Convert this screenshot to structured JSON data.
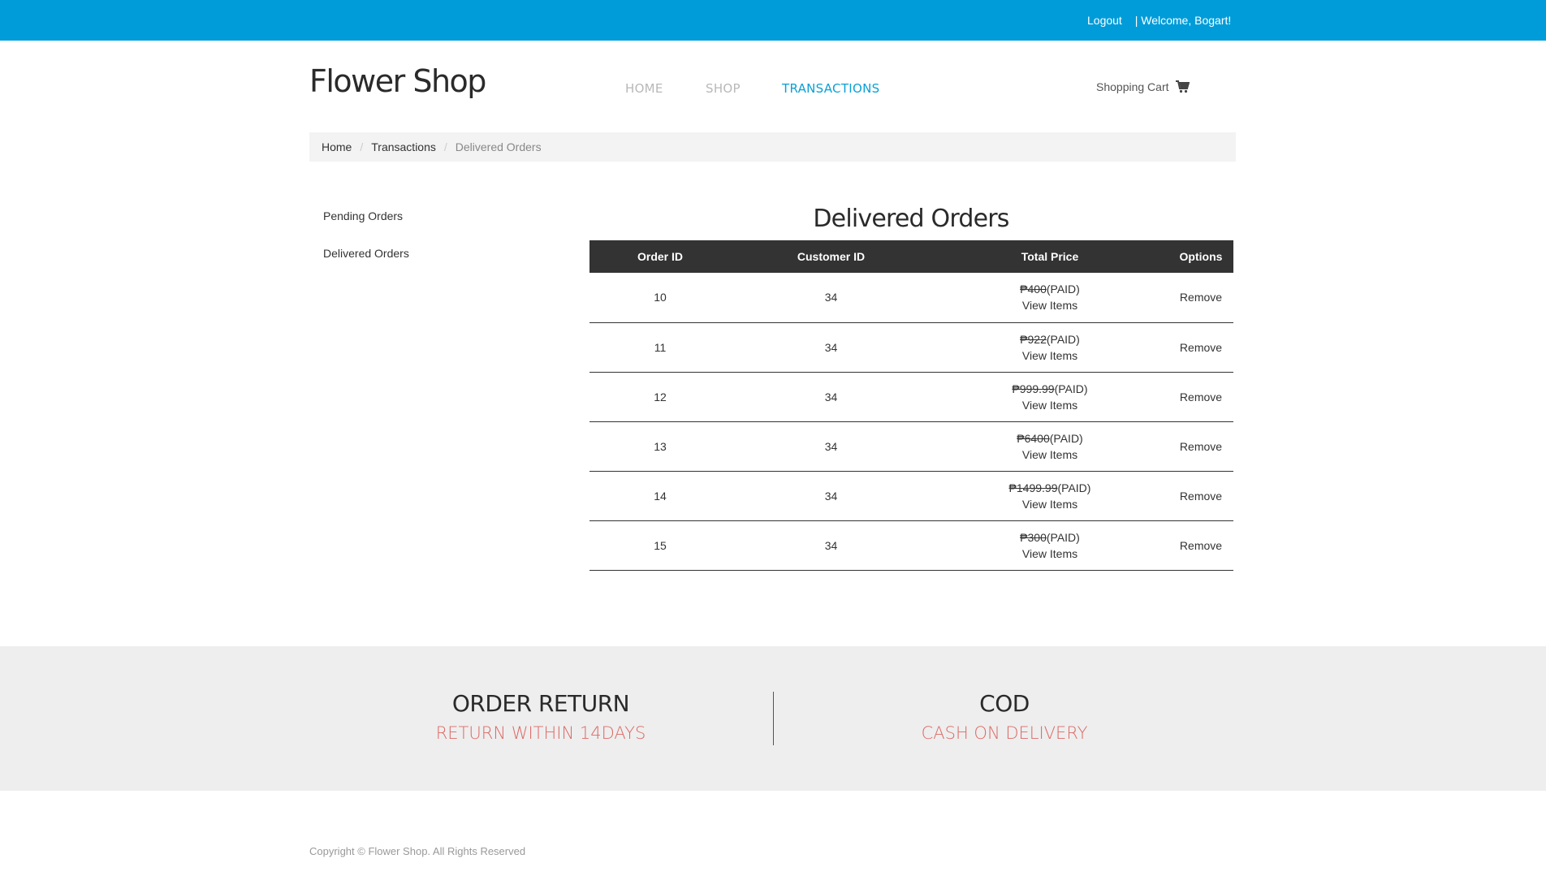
{
  "topbar": {
    "logout": "Logout",
    "welcome": "| Welcome,  Bogart!"
  },
  "header": {
    "logo": "Flower Shop",
    "nav": {
      "home": "HOME",
      "shop": "SHOP",
      "transactions": "TRANSACTIONS"
    },
    "cart_label": "Shopping Cart",
    "cart_icon": "shopping-cart-icon"
  },
  "breadcrumb": [
    "Home",
    "Transactions",
    "Delivered Orders"
  ],
  "sidebar": [
    "Pending Orders",
    "Delivered Orders"
  ],
  "main": {
    "title": "Delivered Orders",
    "columns": [
      "Order ID",
      "Customer ID",
      "Total Price",
      "Options"
    ],
    "rows": [
      {
        "order_id": "10",
        "customer_id": "34",
        "price": "₱400",
        "status": "(PAID)",
        "view": "View Items",
        "option": "Remove"
      },
      {
        "order_id": "11",
        "customer_id": "34",
        "price": "₱922",
        "status": "(PAID)",
        "view": "View Items",
        "option": "Remove"
      },
      {
        "order_id": "12",
        "customer_id": "34",
        "price": "₱999.99",
        "status": "(PAID)",
        "view": "View Items",
        "option": "Remove"
      },
      {
        "order_id": "13",
        "customer_id": "34",
        "price": "₱6400",
        "status": "(PAID)",
        "view": "View Items",
        "option": "Remove"
      },
      {
        "order_id": "14",
        "customer_id": "34",
        "price": "₱1499.99",
        "status": "(PAID)",
        "view": "View Items",
        "option": "Remove"
      },
      {
        "order_id": "15",
        "customer_id": "34",
        "price": "₱300",
        "status": "(PAID)",
        "view": "View Items",
        "option": "Remove"
      }
    ]
  },
  "features": [
    {
      "title": "ORDER RETURN",
      "subtitle": "RETURN WITHIN 14DAYS"
    },
    {
      "title": "COD",
      "subtitle": "CASH ON DELIVERY"
    }
  ],
  "copyright": "Copyright © Flower Shop. All Rights Reserved",
  "colors": {
    "topbar": "#009cd9",
    "accent_nav": "#0aa0d6",
    "feature_sub": "#d9534f"
  }
}
